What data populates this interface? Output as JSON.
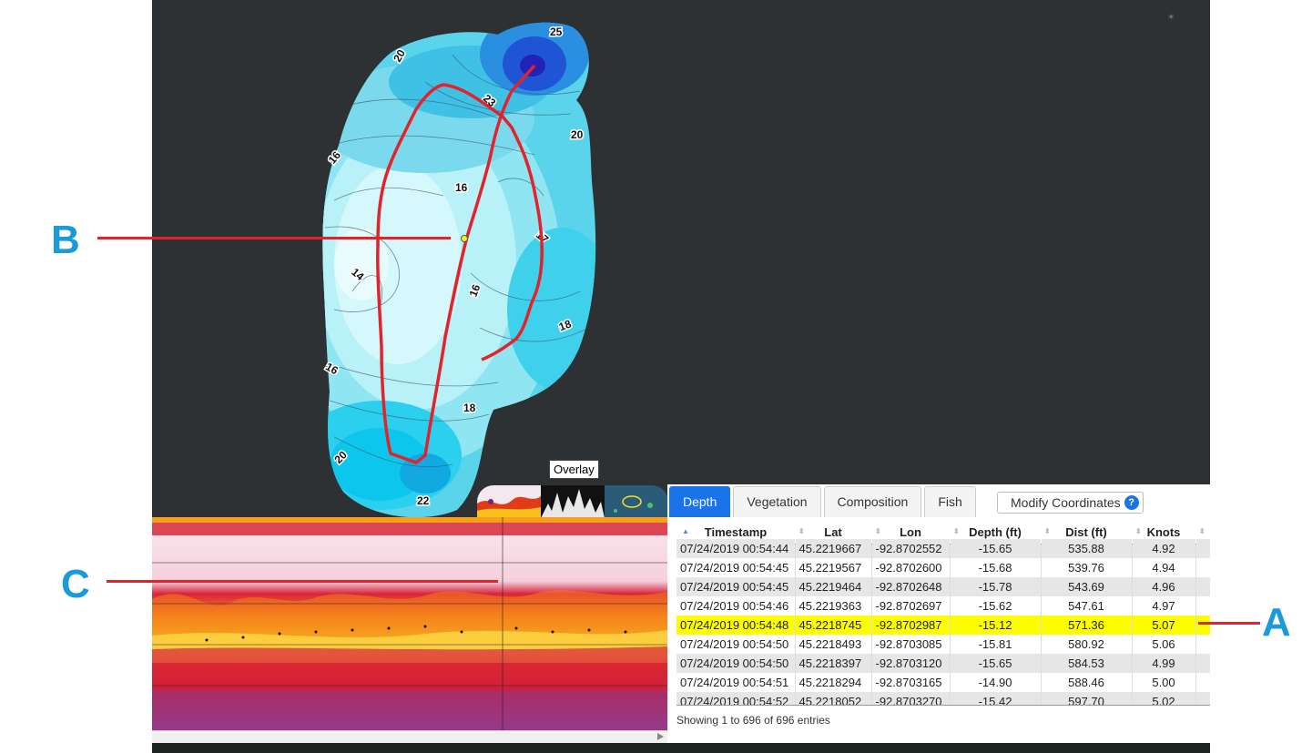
{
  "callouts": {
    "a": "A",
    "b": "B",
    "c": "C"
  },
  "map": {
    "contour_labels": [
      "25",
      "20",
      "23",
      "20",
      "16",
      "16",
      "17",
      "14",
      "16",
      "18",
      "16",
      "18",
      "20",
      "22"
    ]
  },
  "overlay": {
    "tooltip": "Overlay"
  },
  "tabs": [
    {
      "label": "Depth",
      "active": true
    },
    {
      "label": "Vegetation",
      "active": false
    },
    {
      "label": "Composition",
      "active": false
    },
    {
      "label": "Fish",
      "active": false
    }
  ],
  "modify_button": {
    "label": "Modify Coordinates",
    "icon": "help-icon",
    "icon_text": "?"
  },
  "table": {
    "columns": [
      "Timestamp",
      "Lat",
      "Lon",
      "Depth (ft)",
      "Dist (ft)",
      "Knots"
    ],
    "sorted_column_indicator": "▲",
    "rows": [
      [
        "07/24/2019 00:54:44",
        "45.2219667",
        "-92.8702552",
        "-15.65",
        "535.88",
        "4.92"
      ],
      [
        "07/24/2019 00:54:45",
        "45.2219567",
        "-92.8702600",
        "-15.68",
        "539.76",
        "4.94"
      ],
      [
        "07/24/2019 00:54:45",
        "45.2219464",
        "-92.8702648",
        "-15.78",
        "543.69",
        "4.96"
      ],
      [
        "07/24/2019 00:54:46",
        "45.2219363",
        "-92.8702697",
        "-15.62",
        "547.61",
        "4.97"
      ],
      [
        "07/24/2019 00:54:48",
        "45.2218745",
        "-92.8702987",
        "-15.12",
        "571.36",
        "5.07"
      ],
      [
        "07/24/2019 00:54:50",
        "45.2218493",
        "-92.8703085",
        "-15.81",
        "580.92",
        "5.06"
      ],
      [
        "07/24/2019 00:54:50",
        "45.2218397",
        "-92.8703120",
        "-15.65",
        "584.53",
        "4.99"
      ],
      [
        "07/24/2019 00:54:51",
        "45.2218294",
        "-92.8703165",
        "-14.90",
        "588.46",
        "5.00"
      ],
      [
        "07/24/2019 00:54:52",
        "45.2218052",
        "-92.8703270",
        "-15.42",
        "597.70",
        "5.02"
      ]
    ],
    "selected_row": 4,
    "info": "Showing 1 to 696 of 696 entries"
  },
  "colors": {
    "accent": "#1a73e8",
    "callout": "#1a9ad8",
    "track": "#e2232b",
    "highlight": "#fdfd00"
  }
}
